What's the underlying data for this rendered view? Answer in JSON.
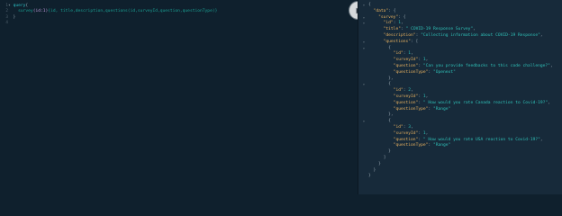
{
  "editor": {
    "line_numbers": [
      "1",
      "2",
      "3",
      "4"
    ],
    "fold_marker": "▾",
    "line1": {
      "keyword": "query",
      "brace": "{"
    },
    "line2": {
      "field": "survey",
      "args": "(id:1)",
      "selection": "{id, title,description,questions(id,surveyId,question,questionType)}"
    },
    "line3": {
      "brace": "}"
    }
  },
  "run_button": {
    "icon": "play-icon"
  },
  "result": {
    "gutter": [
      "▾",
      "",
      "▾",
      "▾",
      "",
      "",
      "▾",
      "▾",
      "",
      "",
      "",
      "",
      "",
      "▾",
      "",
      "",
      "",
      "",
      "",
      "▾",
      "",
      "",
      "",
      "",
      "",
      "",
      "",
      "",
      ""
    ],
    "lines": [
      [
        [
          "p",
          "{"
        ]
      ],
      [
        [
          "p",
          "  "
        ],
        [
          "k",
          "\"data\""
        ],
        [
          "p",
          ": {"
        ]
      ],
      [
        [
          "p",
          "    "
        ],
        [
          "k",
          "\"survey\""
        ],
        [
          "p",
          ": {"
        ]
      ],
      [
        [
          "p",
          "      "
        ],
        [
          "k",
          "\"id\""
        ],
        [
          "p",
          ": "
        ],
        [
          "n",
          "1"
        ],
        [
          "p",
          ","
        ]
      ],
      [
        [
          "p",
          "      "
        ],
        [
          "k",
          "\"title\""
        ],
        [
          "p",
          ": "
        ],
        [
          "s",
          "\" COVID-19 Response Survey\""
        ],
        [
          "p",
          ","
        ]
      ],
      [
        [
          "p",
          "      "
        ],
        [
          "k",
          "\"description\""
        ],
        [
          "p",
          ": "
        ],
        [
          "s",
          "\"Collecting information about COVID-19 Response\""
        ],
        [
          "p",
          ","
        ]
      ],
      [
        [
          "p",
          "      "
        ],
        [
          "k",
          "\"questions\""
        ],
        [
          "p",
          ": ["
        ]
      ],
      [
        [
          "p",
          "        {"
        ]
      ],
      [
        [
          "p",
          "          "
        ],
        [
          "k",
          "\"id\""
        ],
        [
          "p",
          ": "
        ],
        [
          "n",
          "1"
        ],
        [
          "p",
          ","
        ]
      ],
      [
        [
          "p",
          "          "
        ],
        [
          "k",
          "\"surveyId\""
        ],
        [
          "p",
          ": "
        ],
        [
          "n",
          "1"
        ],
        [
          "p",
          ","
        ]
      ],
      [
        [
          "p",
          "          "
        ],
        [
          "k",
          "\"question\""
        ],
        [
          "p",
          ": "
        ],
        [
          "s",
          "\"Can you provide feedbacks to this code challenge?\""
        ],
        [
          "p",
          ","
        ]
      ],
      [
        [
          "p",
          "          "
        ],
        [
          "k",
          "\"questionType\""
        ],
        [
          "p",
          ": "
        ],
        [
          "s",
          "\"Openext\""
        ]
      ],
      [
        [
          "p",
          "        },"
        ]
      ],
      [
        [
          "p",
          "        {"
        ]
      ],
      [
        [
          "p",
          "          "
        ],
        [
          "k",
          "\"id\""
        ],
        [
          "p",
          ": "
        ],
        [
          "n",
          "2"
        ],
        [
          "p",
          ","
        ]
      ],
      [
        [
          "p",
          "          "
        ],
        [
          "k",
          "\"surveyId\""
        ],
        [
          "p",
          ": "
        ],
        [
          "n",
          "1"
        ],
        [
          "p",
          ","
        ]
      ],
      [
        [
          "p",
          "          "
        ],
        [
          "k",
          "\"question\""
        ],
        [
          "p",
          ": "
        ],
        [
          "s",
          "\" How would you rate Canada reaction to Covid-19?\""
        ],
        [
          "p",
          ","
        ]
      ],
      [
        [
          "p",
          "          "
        ],
        [
          "k",
          "\"questionType\""
        ],
        [
          "p",
          ": "
        ],
        [
          "s",
          "\"Range\""
        ]
      ],
      [
        [
          "p",
          "        },"
        ]
      ],
      [
        [
          "p",
          "        {"
        ]
      ],
      [
        [
          "p",
          "          "
        ],
        [
          "k",
          "\"id\""
        ],
        [
          "p",
          ": "
        ],
        [
          "n",
          "3"
        ],
        [
          "p",
          ","
        ]
      ],
      [
        [
          "p",
          "          "
        ],
        [
          "k",
          "\"surveyId\""
        ],
        [
          "p",
          ": "
        ],
        [
          "n",
          "1"
        ],
        [
          "p",
          ","
        ]
      ],
      [
        [
          "p",
          "          "
        ],
        [
          "k",
          "\"question\""
        ],
        [
          "p",
          ": "
        ],
        [
          "s",
          "\" How would you rate USA reaction to Covid-19?\""
        ],
        [
          "p",
          ","
        ]
      ],
      [
        [
          "p",
          "          "
        ],
        [
          "k",
          "\"questionType\""
        ],
        [
          "p",
          ": "
        ],
        [
          "s",
          "\"Range\""
        ]
      ],
      [
        [
          "p",
          "        }"
        ]
      ],
      [
        [
          "p",
          "      ]"
        ]
      ],
      [
        [
          "p",
          "    }"
        ]
      ],
      [
        [
          "p",
          "  }"
        ]
      ],
      [
        [
          "p",
          "}"
        ]
      ]
    ]
  }
}
